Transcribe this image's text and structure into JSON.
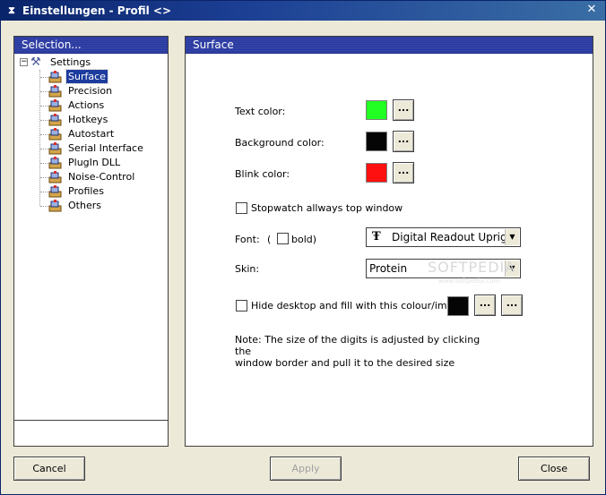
{
  "window": {
    "title": "Einstellungen - Profil <>",
    "close_glyph": "✕"
  },
  "sidebar": {
    "header": "Selection...",
    "root_label": "Settings",
    "items": [
      {
        "label": "Surface",
        "selected": true
      },
      {
        "label": "Precision"
      },
      {
        "label": "Actions"
      },
      {
        "label": "Hotkeys"
      },
      {
        "label": "Autostart"
      },
      {
        "label": "Serial Interface"
      },
      {
        "label": "PlugIn DLL"
      },
      {
        "label": "Noise-Control"
      },
      {
        "label": "Profiles"
      },
      {
        "label": "Others"
      }
    ]
  },
  "surface": {
    "header": "Surface",
    "text_color_label": "Text color:",
    "text_color": "#22ff22",
    "background_color_label": "Background color:",
    "background_color": "#050505",
    "blink_color_label": "Blink color:",
    "blink_color": "#ff1010",
    "dots_label": "...",
    "stopwatch_label": "Stopwatch allways top window",
    "stopwatch_checked": false,
    "font_label": "Font:",
    "font_paren": "(",
    "bold_label": "bold)",
    "bold_checked": false,
    "font_value": "Digital Readout Upright",
    "font_icon": "Ŧ",
    "skin_label": "Skin:",
    "skin_value": "Protein",
    "hide_desktop_label": "Hide desktop and fill with this colour/image:",
    "hide_desktop_checked": false,
    "hide_desktop_color": "#050505",
    "note_line1": "Note: The size of the digits is adjusted by clicking the",
    "note_line2": "window border and pull it to the desired size",
    "watermark": "SOFTPEDIA",
    "watermark_sub": "www.softpedia.com"
  },
  "buttons": {
    "cancel": "Cancel",
    "apply": "Apply",
    "close": "Close"
  },
  "colors": {
    "title_bar": "#0a246a",
    "panel_header": "#2a3a98",
    "selection": "#1d3c9e"
  }
}
